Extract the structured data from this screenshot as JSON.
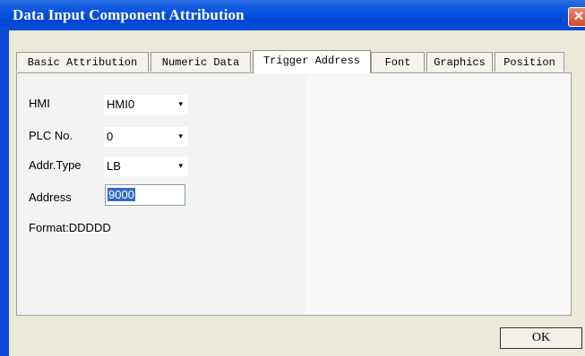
{
  "window": {
    "title": "Data Input Component Attribution",
    "close_symbol": "✕"
  },
  "tabs": [
    {
      "label": "Basic Attribution"
    },
    {
      "label": "Numeric Data"
    },
    {
      "label": "Trigger Address"
    },
    {
      "label": "Font"
    },
    {
      "label": "Graphics"
    },
    {
      "label": "Position"
    }
  ],
  "active_tab": "Trigger Address",
  "form": {
    "hmi": {
      "label": "HMI",
      "value": "HMI0"
    },
    "plc_no": {
      "label": "PLC No.",
      "value": "0"
    },
    "addr_type": {
      "label": "Addr.Type",
      "value": "LB"
    },
    "address": {
      "label": "Address",
      "value": "9000"
    },
    "format": {
      "text": "Format:DDDDD"
    }
  },
  "buttons": {
    "ok": "OK"
  },
  "icons": {
    "dropdown": "▾"
  }
}
